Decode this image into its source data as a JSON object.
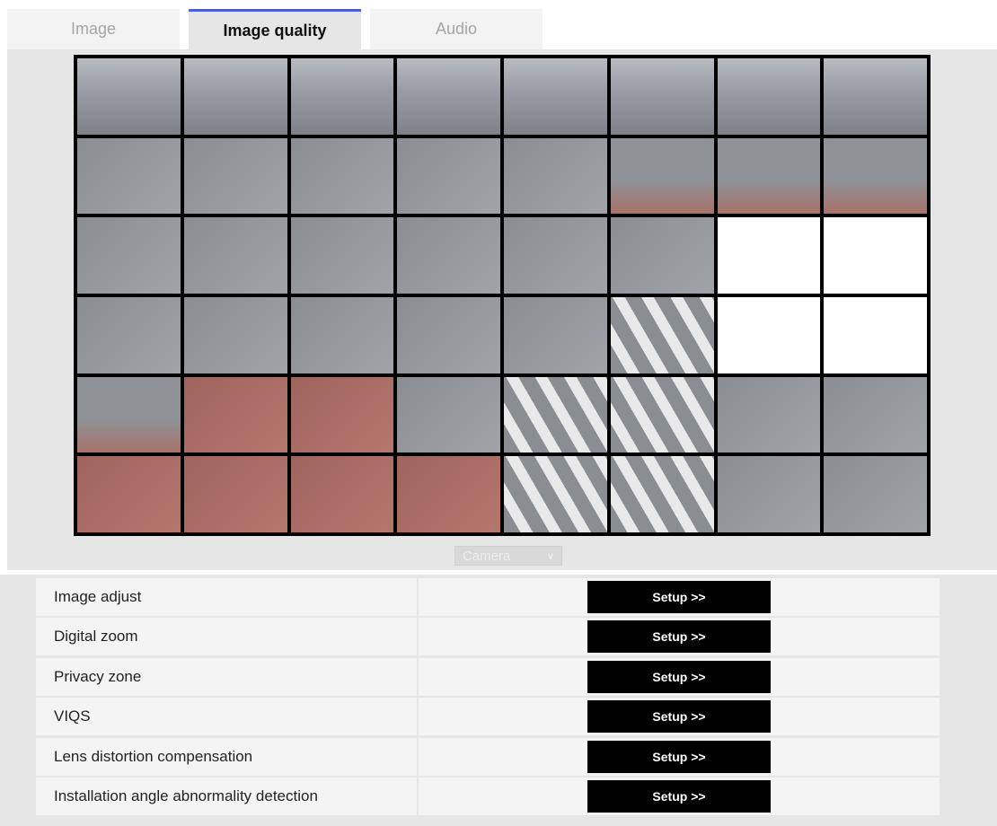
{
  "tabs": [
    {
      "label": "Image",
      "active": false
    },
    {
      "label": "Image quality",
      "active": true
    },
    {
      "label": "Audio",
      "active": false
    }
  ],
  "accent_color": "#4a5fd1",
  "camera_select": {
    "value": "Camera"
  },
  "settings": [
    {
      "label": "Image adjust",
      "button": "Setup >>"
    },
    {
      "label": "Digital zoom",
      "button": "Setup >>"
    },
    {
      "label": "Privacy zone",
      "button": "Setup >>"
    },
    {
      "label": "VIQS",
      "button": "Setup >>"
    },
    {
      "label": "Lens distortion compensation",
      "button": "Setup >>"
    },
    {
      "label": "Installation angle abnormality detection",
      "button": "Setup >>"
    }
  ]
}
